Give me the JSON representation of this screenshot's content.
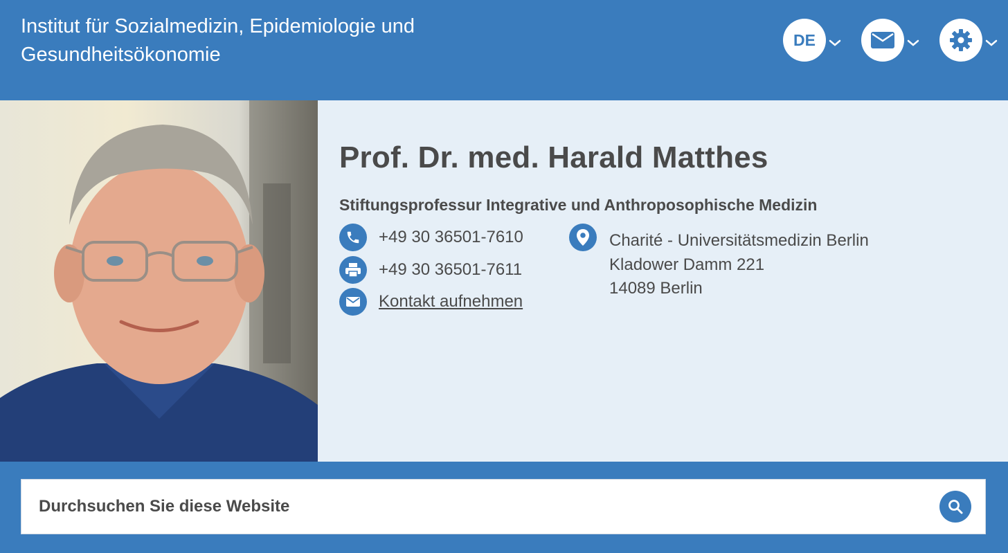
{
  "header": {
    "title_line1": "Institut für Sozialmedizin, Epidemiologie und",
    "title_line2": "Gesundheitsökonomie",
    "language_label": "DE",
    "icons": [
      "chevron-down-icon",
      "envelope-icon",
      "gear-icon"
    ]
  },
  "profile": {
    "name": "Prof. Dr. med. Harald Matthes",
    "role": "Stiftungsprofessur Integrative und Anthroposophische Medizin",
    "phone": "+49 30 36501-7610",
    "fax": "+49 30 36501-7611",
    "contact_link": "Kontakt aufnehmen",
    "address": {
      "line1": "Charité - Universitätsmedizin Berlin",
      "line2": "Kladower Damm 221",
      "line3": "14089 Berlin"
    },
    "icons": [
      "phone-icon",
      "printer-icon",
      "envelope-icon",
      "location-pin-icon"
    ]
  },
  "search": {
    "placeholder": "Durchsuchen Sie diese Website",
    "icon": "magnifier-icon"
  },
  "colors": {
    "brand_blue": "#3a7cbd",
    "panel_bg": "#e6eff7",
    "text_dark": "#4a4a4a",
    "white": "#ffffff"
  }
}
